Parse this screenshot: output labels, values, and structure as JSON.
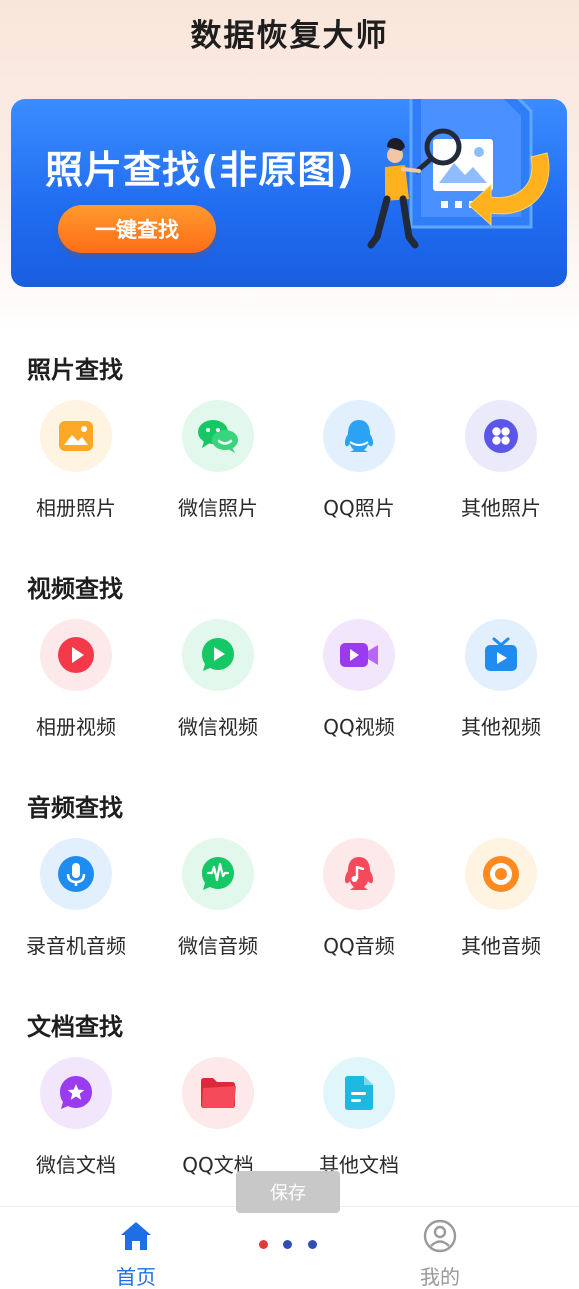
{
  "app": {
    "title": "数据恢复大师"
  },
  "banner": {
    "title": "照片查找(非原图)",
    "button_label": "一键查找"
  },
  "sections": [
    {
      "title": "照片查找",
      "items": [
        {
          "label": "相册照片",
          "icon": "album-photo-icon"
        },
        {
          "label": "微信照片",
          "icon": "wechat-icon"
        },
        {
          "label": "QQ照片",
          "icon": "qq-penguin-icon"
        },
        {
          "label": "其他照片",
          "icon": "grid-flower-icon"
        }
      ]
    },
    {
      "title": "视频查找",
      "items": [
        {
          "label": "相册视频",
          "icon": "play-icon"
        },
        {
          "label": "微信视频",
          "icon": "wechat-video-icon"
        },
        {
          "label": "QQ视频",
          "icon": "video-camera-icon"
        },
        {
          "label": "其他视频",
          "icon": "tv-icon"
        }
      ]
    },
    {
      "title": "音频查找",
      "items": [
        {
          "label": "录音机音频",
          "icon": "microphone-icon"
        },
        {
          "label": "微信音频",
          "icon": "wechat-voice-icon"
        },
        {
          "label": "QQ音频",
          "icon": "qq-music-icon"
        },
        {
          "label": "其他音频",
          "icon": "disc-icon"
        }
      ]
    },
    {
      "title": "文档查找",
      "items": [
        {
          "label": "微信文档",
          "icon": "star-chat-icon"
        },
        {
          "label": "QQ文档",
          "icon": "folder-icon"
        },
        {
          "label": "其他文档",
          "icon": "document-icon"
        }
      ]
    }
  ],
  "toast": {
    "text": "保存"
  },
  "nav": {
    "home_label": "首页",
    "mine_label": "我的",
    "active_color": "#1e6fe6",
    "inactive_color": "#9a9a9a",
    "dot_colors": [
      "#e53935",
      "#2f4fb5",
      "#2f4fb5"
    ]
  },
  "colors": {
    "banner": "#2476f5",
    "button": "#ff7a1f"
  }
}
